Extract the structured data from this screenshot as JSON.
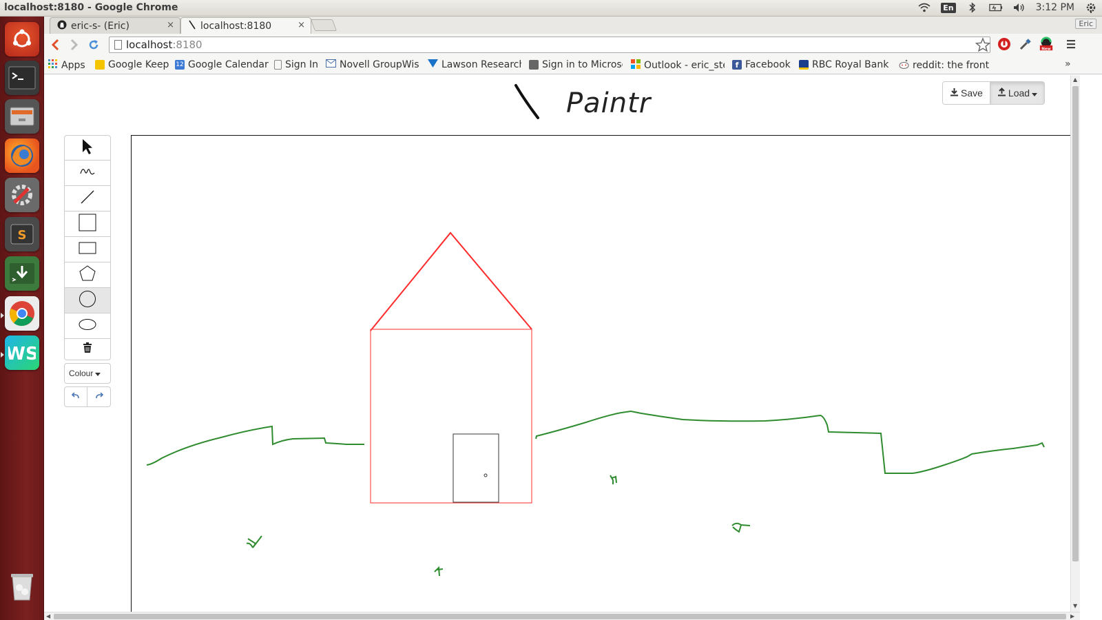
{
  "window": {
    "title": "localhost:8180 - Google Chrome"
  },
  "tray": {
    "language": "En",
    "clock": "3:12 PM",
    "profile": "Eric"
  },
  "launcher": {
    "items": [
      "ubuntu-dash",
      "terminal",
      "files",
      "firefox",
      "system-settings",
      "sublime-text",
      "download-manager",
      "chrome",
      "webstorm"
    ],
    "trash": "trash"
  },
  "tabs": [
    {
      "label": "eric-s- (Eric)",
      "icon": "github-icon",
      "close": "×"
    },
    {
      "label": "localhost:8180",
      "icon": "paintr-brush-icon",
      "close": "×"
    }
  ],
  "omnibox": {
    "host": "localhost",
    "port": ":8180"
  },
  "bookmarks": [
    {
      "label": "Apps",
      "icon": "apps-grid-icon",
      "color": "#4a90d9"
    },
    {
      "label": "Google Keep",
      "icon": "keep-icon",
      "color": "#f5c400"
    },
    {
      "label": "Google Calendar",
      "icon": "calendar-icon",
      "color": "#3d7ad6"
    },
    {
      "label": "Sign In",
      "icon": "page-icon",
      "color": "#888888"
    },
    {
      "label": "Novell GroupWise",
      "icon": "mail-icon",
      "color": "#4a6fa5"
    },
    {
      "label": "Lawson Research",
      "icon": "lawson-icon",
      "color": "#1a73c9"
    },
    {
      "label": "Sign in to Microso",
      "icon": "microsoft-icon",
      "color": "#444444"
    },
    {
      "label": "Outlook - eric_ste",
      "icon": "outlook-icon",
      "color": "#e74c3c"
    },
    {
      "label": "Facebook",
      "icon": "facebook-icon",
      "color": "#3b5998"
    },
    {
      "label": "RBC Royal Bank -",
      "icon": "rbc-icon",
      "color": "#1a3e8c"
    },
    {
      "label": "reddit: the front p",
      "icon": "reddit-icon",
      "color": "#888888"
    }
  ],
  "app": {
    "name": "Paintr",
    "save_label": "Save",
    "load_label": "Load",
    "colour_label": "Colour",
    "tools": [
      "select",
      "freehand",
      "line",
      "square",
      "rectangle",
      "polygon",
      "circle",
      "ellipse",
      "delete"
    ],
    "active_tool": "circle"
  },
  "colors": {
    "roof": "#ff2a2a",
    "house": "#ff4d4d",
    "grass": "#2e8b2e",
    "door": "#333333",
    "accent": "#4a76b4"
  }
}
